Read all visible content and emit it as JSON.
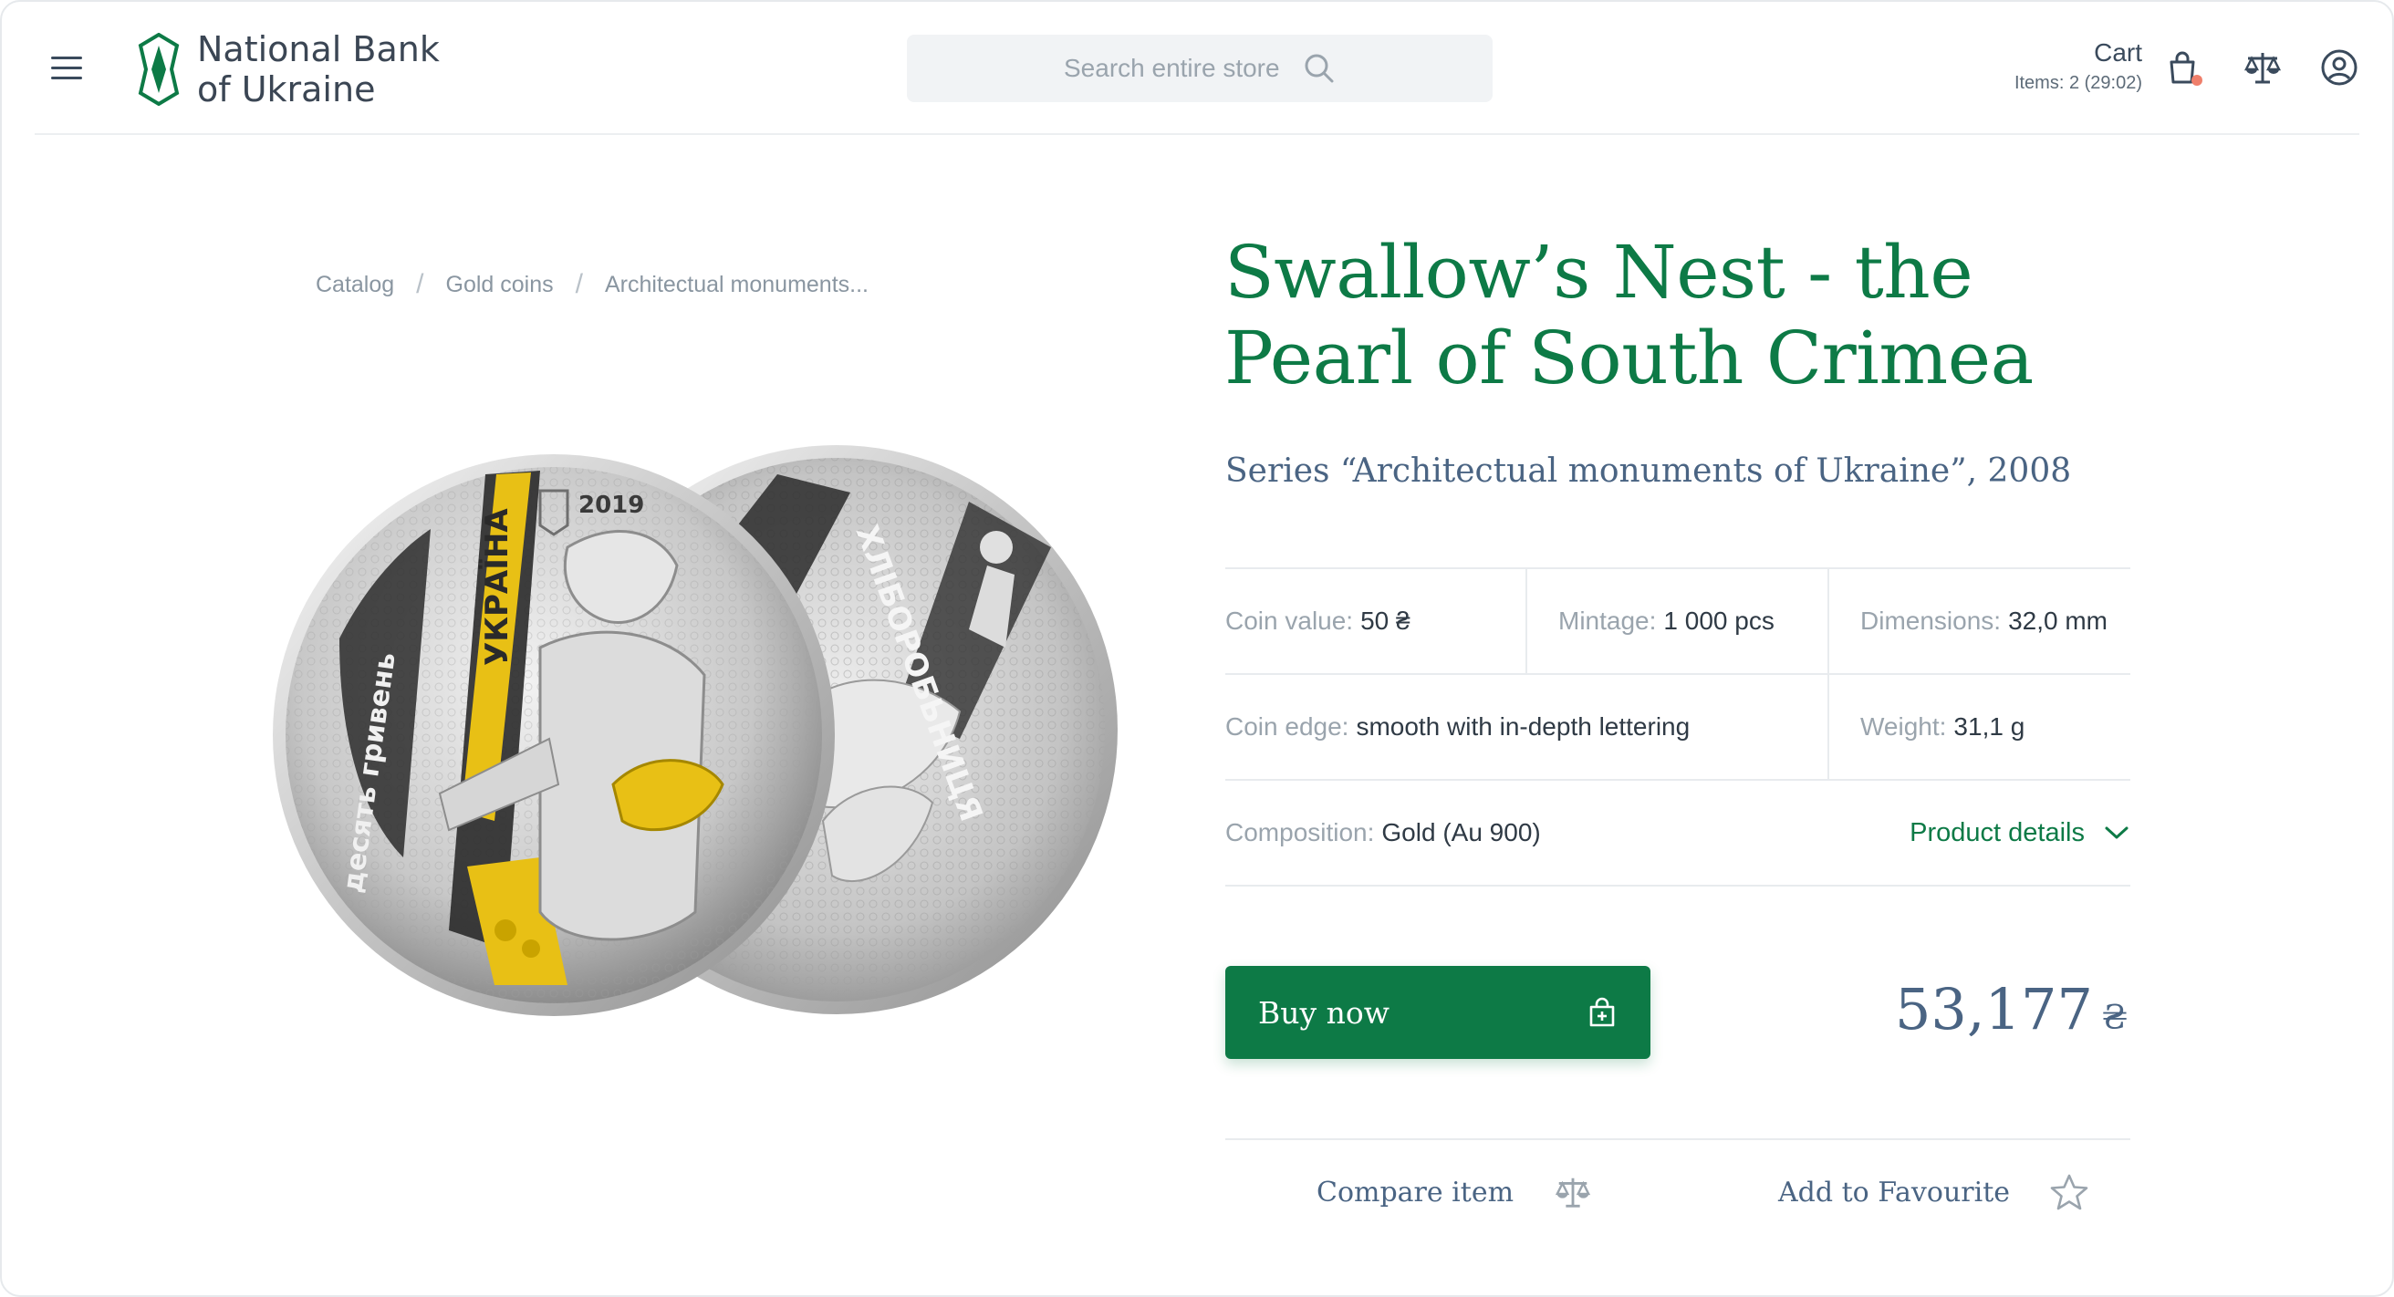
{
  "header": {
    "logo_line1": "National Bank",
    "logo_line2": "of Ukraine",
    "search_placeholder": "Search entire store",
    "cart_title": "Cart",
    "cart_items": "Items: 2 (29:02)",
    "icons": [
      "menu-icon",
      "search-icon",
      "bag-icon",
      "compare-scales-icon",
      "user-icon"
    ]
  },
  "breadcrumb": [
    "Catalog",
    "Gold coins",
    "Architectual monuments..."
  ],
  "product": {
    "title": "Swallow’s Nest - the Pearl of South Crimea",
    "series": "Series “Architectual monuments of Ukraine”, 2008",
    "specs": {
      "coin_value_label": "Coin value:",
      "coin_value": "50 ₴",
      "mintage_label": "Mintage:",
      "mintage": "1 000 pcs",
      "dimensions_label": "Dimensions:",
      "dimensions": "32,0 mm",
      "edge_label": "Coin edge:",
      "edge": "smooth with in-depth lettering",
      "weight_label": "Weight:",
      "weight": "31,1 g",
      "composition_label": "Composition:",
      "composition": "Gold (Au 900)"
    },
    "details_link": "Product details",
    "buy_label": "Buy now",
    "price": "53,177",
    "currency": "₴",
    "compare_label": "Compare item",
    "favourite_label": "Add to Favourite"
  },
  "coin": {
    "year": "2019",
    "obverse_word": "УКРАЇНА",
    "obverse_value": "десять гривень",
    "reverse_word": "ХЛІБОРОБЬНИЦЯ"
  },
  "colors": {
    "brand_green": "#0d7a46",
    "heading_blue": "#4a6483",
    "gold": "#e8c015",
    "notification": "#ef7f6b"
  }
}
